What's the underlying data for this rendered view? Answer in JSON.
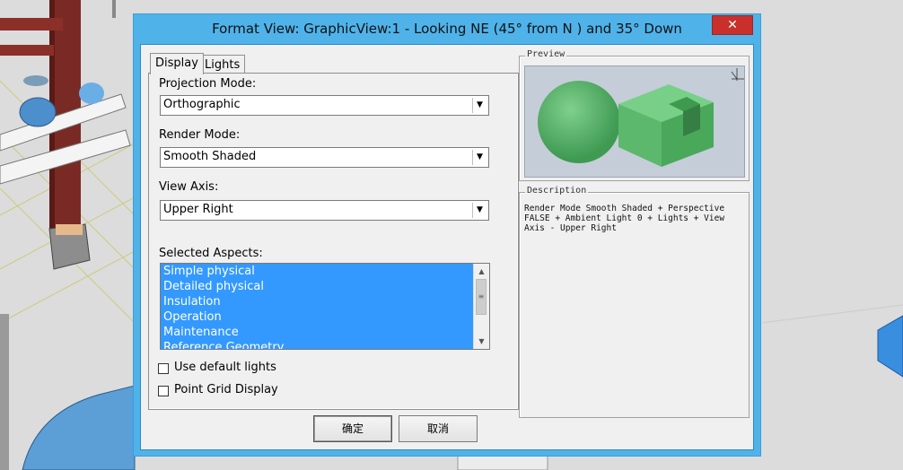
{
  "dialog": {
    "title": "Format View: GraphicView:1 - Looking NE (45° from N ) and 35° Down",
    "close_glyph": "✕"
  },
  "tabs": [
    {
      "label": "Display",
      "active": true
    },
    {
      "label": "Lights",
      "active": false
    }
  ],
  "display": {
    "projection_label": "Projection Mode:",
    "projection_value": "Orthographic",
    "render_label": "Render Mode:",
    "render_value": "Smooth Shaded",
    "view_axis_label": "View Axis:",
    "view_axis_value": "Upper Right",
    "aspects_label": "Selected Aspects:",
    "aspects": [
      "Simple physical",
      "Detailed physical",
      "Insulation",
      "Operation",
      "Maintenance",
      "Reference Geometry"
    ],
    "use_default_lights_label": "Use default lights",
    "use_default_lights_checked": false,
    "point_grid_label": "Point Grid Display",
    "point_grid_checked": false
  },
  "preview": {
    "title": "Preview",
    "icon": "axis-triad-icon"
  },
  "description": {
    "title": "Description",
    "lines": [
      "Render Mode Smooth Shaded + Perspective",
      "FALSE + Ambient Light 0 + Lights + View",
      "Axis - Upper Right"
    ]
  },
  "buttons": {
    "ok": "确定",
    "cancel": "取消"
  },
  "colors": {
    "title_bar": "#4fb3ea",
    "selection": "#3399ff",
    "close_button": "#c9302c",
    "preview_bg": "#c5cdd8",
    "preview_object": "#5cb86c"
  }
}
